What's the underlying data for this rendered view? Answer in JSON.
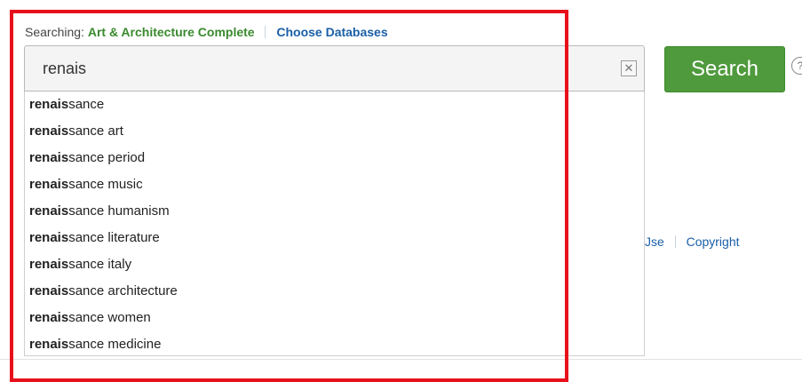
{
  "search_header": {
    "searching_label": "Searching:",
    "database_name": "Art & Architecture Complete",
    "choose_databases_label": "Choose Databases"
  },
  "search": {
    "input_value": "renais",
    "clear_icon": "close-icon",
    "button_label": "Search",
    "help_icon": "help-icon"
  },
  "suggestions": [
    {
      "match": "renais",
      "rest": "sance"
    },
    {
      "match": "renais",
      "rest": "sance art"
    },
    {
      "match": "renais",
      "rest": "sance period"
    },
    {
      "match": "renais",
      "rest": "sance music"
    },
    {
      "match": "renais",
      "rest": "sance humanism"
    },
    {
      "match": "renais",
      "rest": "sance literature"
    },
    {
      "match": "renais",
      "rest": "sance italy"
    },
    {
      "match": "renais",
      "rest": "sance architecture"
    },
    {
      "match": "renais",
      "rest": "sance women"
    },
    {
      "match": "renais",
      "rest": "sance medicine"
    }
  ],
  "footer_links": {
    "terms_of_use_partial": "Jse",
    "copyright": "Copyright"
  },
  "colors": {
    "accent_green": "#4f9a3c",
    "link_blue": "#1a5fa8",
    "database_green": "#3a8a2e",
    "highlight_red": "#e8101a"
  }
}
